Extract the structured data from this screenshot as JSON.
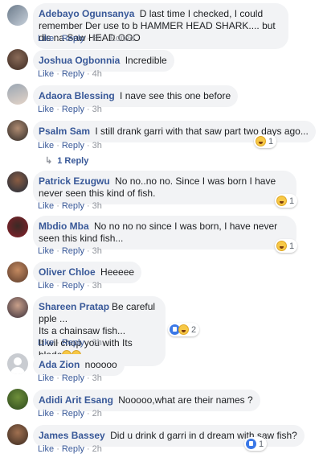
{
  "labels": {
    "like": "Like",
    "reply": "Reply",
    "edited": "Edited",
    "separator": "·"
  },
  "comments": [
    {
      "name": "Adebayo Ogunsanya",
      "text": "D last time I checked, I could remember Der use to b HAMMER HEAD SHARK.... but dis na Saw HEAD OOO",
      "time": "5h",
      "edited": true,
      "avatar_colors": [
        "#6b7a8a",
        "#c9d2dc"
      ]
    },
    {
      "name": "Joshua Ogbonnia",
      "text": "Incredible",
      "time": "4h",
      "avatar_colors": [
        "#3d2a22",
        "#8a6b58"
      ]
    },
    {
      "name": "Adaora Blessing",
      "text": "I nave see this one before",
      "time": "3h",
      "avatar_colors": [
        "#9aa6b3",
        "#e4d4c8"
      ]
    },
    {
      "name": "Psalm Sam",
      "text": "I still drank garri with that saw part two days ago...",
      "time": "3h",
      "reaction_count": "1",
      "reply_count_label": "1 Reply",
      "avatar_colors": [
        "#2f2a27",
        "#b08c72"
      ]
    },
    {
      "name": "Patrick Ezugwu",
      "text": "No no..no no. Since I was born I have never seen this kind of fish.",
      "time": "3h",
      "reaction_count": "1",
      "avatar_colors": [
        "#1f2b3a",
        "#8b5d43"
      ]
    },
    {
      "name": "Mbdio Mba",
      "text": "No no no no since I was born, I have never seen this kind fish...",
      "time": "3h",
      "reaction_count": "1",
      "avatar_colors": [
        "#8a1f2a",
        "#3a2a25"
      ]
    },
    {
      "name": "Oliver Chloe",
      "text": "Heeeee",
      "time": "3h",
      "avatar_colors": [
        "#5a3a2a",
        "#c48a60"
      ]
    },
    {
      "name": "Shareen Pratap",
      "line1": "Be careful pple ...",
      "line2": "Its a chainsaw fish...",
      "line3": "It wil chop you with Its blade",
      "time": "3h",
      "reaction_count": "2",
      "avatar_colors": [
        "#3a2f3a",
        "#c9a08a"
      ]
    },
    {
      "name": "Ada Zion",
      "text": "nooooo",
      "time": "3h",
      "avatar_colors": [
        "#bfc3c8",
        "#dfe1e4"
      ]
    },
    {
      "name": "Adidi Arit Esang",
      "text": "Nooooo,what are their names ?",
      "time": "2h",
      "avatar_colors": [
        "#2e4a1e",
        "#6e8f3a"
      ]
    },
    {
      "name": "James Bassey",
      "text": "Did u drink d garri in d dream with saw fish?",
      "time": "2h",
      "reaction_count": "1",
      "avatar_colors": [
        "#3a2a20",
        "#a07050"
      ]
    }
  ]
}
